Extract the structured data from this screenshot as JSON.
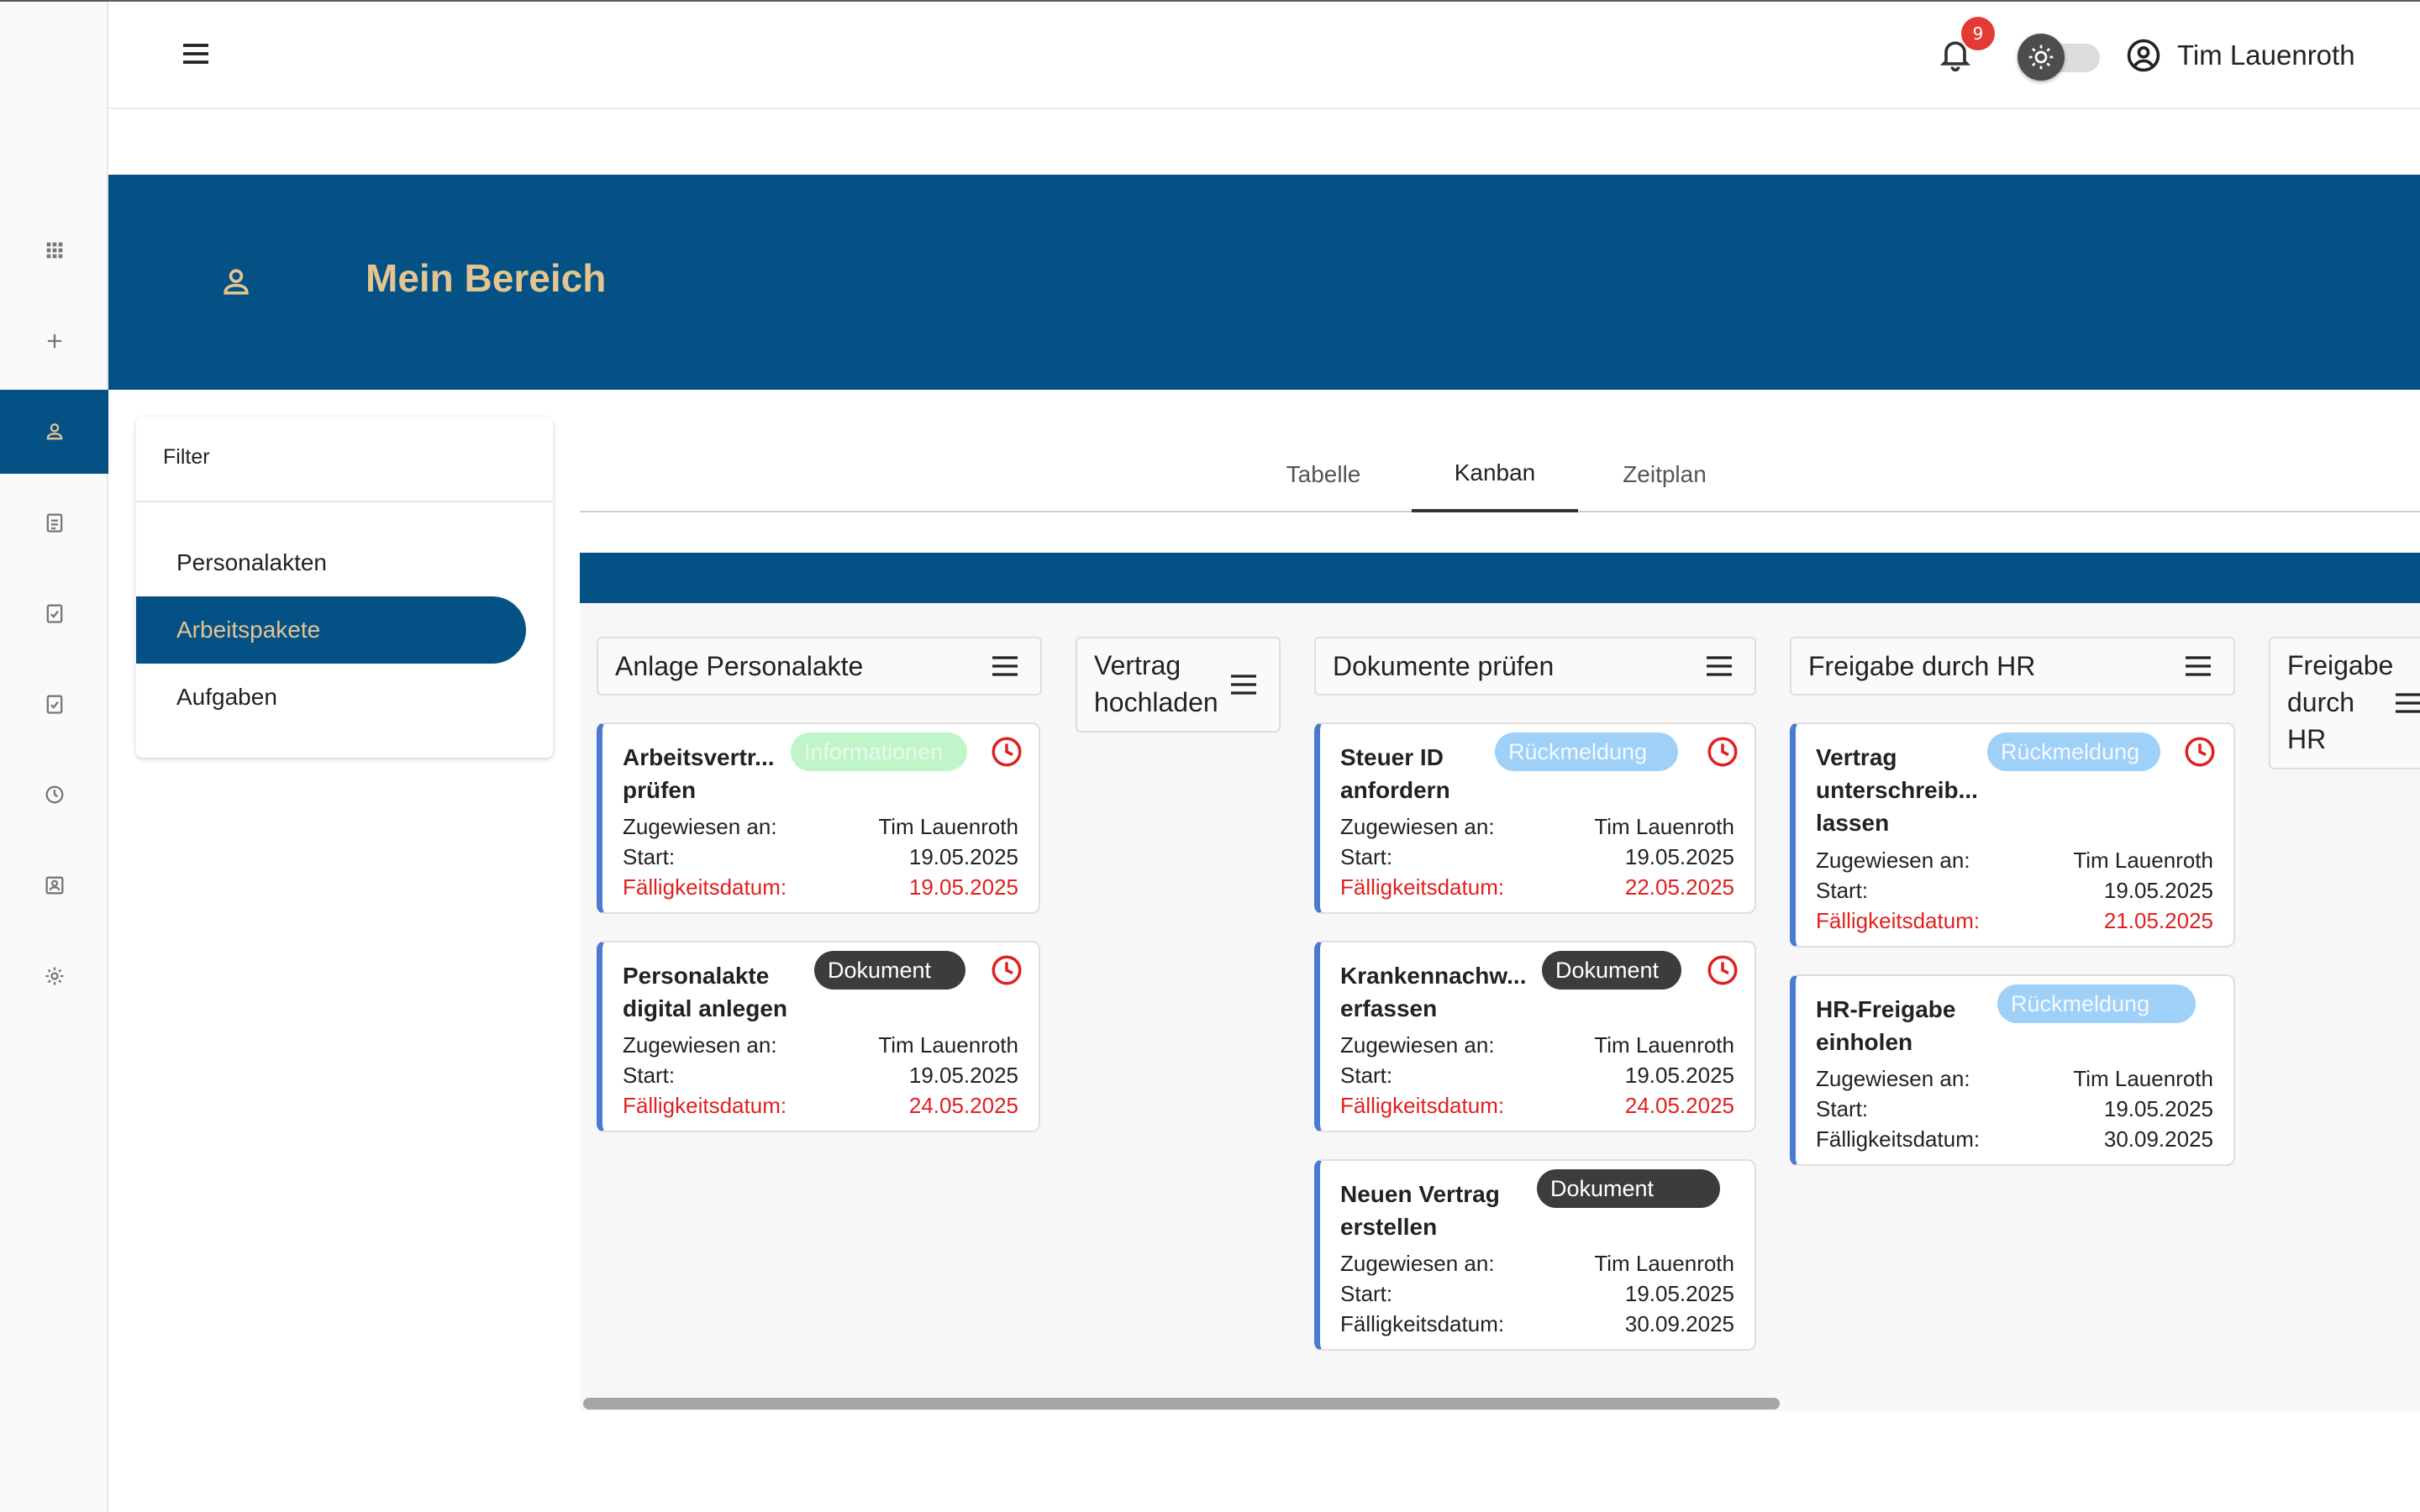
{
  "colors": {
    "primary": "#045186",
    "accent": "#e3c590",
    "due": "#e02020",
    "notification": "#e53935"
  },
  "rail": {
    "items": [
      {
        "icon": "apps-grid-icon"
      },
      {
        "icon": "plus-icon"
      },
      {
        "icon": "person-icon",
        "active": true
      },
      {
        "icon": "clipboard-icon"
      },
      {
        "icon": "clipboard-check-icon"
      },
      {
        "icon": "clipboard-check-icon"
      },
      {
        "icon": "clock-icon"
      },
      {
        "icon": "contact-card-icon"
      },
      {
        "icon": "gear-icon"
      }
    ]
  },
  "topbar": {
    "menu_icon": "hamburger-menu-icon",
    "notification_count": "9",
    "theme_icon": "sun-icon",
    "user_name": "Tim Lauenroth"
  },
  "header": {
    "icon": "person-icon",
    "title": "Mein Bereich"
  },
  "filter": {
    "title": "Filter",
    "items": [
      {
        "label": "Personalakten",
        "active": false
      },
      {
        "label": "Arbeitspakete",
        "active": true
      },
      {
        "label": "Aufgaben",
        "active": false
      }
    ]
  },
  "tabs": [
    {
      "label": "Tabelle",
      "active": false
    },
    {
      "label": "Kanban",
      "active": true
    },
    {
      "label": "Zeitplan",
      "active": false
    }
  ],
  "kanban": {
    "columns": [
      {
        "title": "Anlage Personalakte",
        "cards": [
          {
            "title": "Arbeitsvertr... prüfen",
            "tag": "Informationen",
            "assigned_label": "Zugewiesen an:",
            "assigned": "Tim Lauenroth",
            "start_label": "Start:",
            "start": "19.05.2025",
            "due_label": "Fälligkeitsdatum:",
            "due": "19.05.2025",
            "overdue": true
          },
          {
            "title": "Personalakte digital anlegen",
            "tag": "Dokument",
            "assigned_label": "Zugewiesen an:",
            "assigned": "Tim Lauenroth",
            "start_label": "Start:",
            "start": "19.05.2025",
            "due_label": "Fälligkeitsdatum:",
            "due": "24.05.2025",
            "overdue": true
          }
        ]
      },
      {
        "title": "Vertrag hochladen",
        "cards": []
      },
      {
        "title": "Dokumente prüfen",
        "cards": [
          {
            "title": "Steuer ID anfordern",
            "tag": "Rückmeldung",
            "assigned_label": "Zugewiesen an:",
            "assigned": "Tim Lauenroth",
            "start_label": "Start:",
            "start": "19.05.2025",
            "due_label": "Fälligkeitsdatum:",
            "due": "22.05.2025",
            "overdue": true
          },
          {
            "title": "Krankennachw... erfassen",
            "tag": "Dokument",
            "assigned_label": "Zugewiesen an:",
            "assigned": "Tim Lauenroth",
            "start_label": "Start:",
            "start": "19.05.2025",
            "due_label": "Fälligkeitsdatum:",
            "due": "24.05.2025",
            "overdue": true
          },
          {
            "title": "Neuen Vertrag erstellen",
            "tag": "Dokument",
            "assigned_label": "Zugewiesen an:",
            "assigned": "Tim Lauenroth",
            "start_label": "Start:",
            "start": "19.05.2025",
            "due_label": "Fälligkeitsdatum:",
            "due": "30.09.2025",
            "overdue": false
          }
        ]
      },
      {
        "title": "Freigabe durch HR",
        "cards": [
          {
            "title": "Vertrag unterschreib... lassen",
            "tag": "Rückmeldung",
            "assigned_label": "Zugewiesen an:",
            "assigned": "Tim Lauenroth",
            "start_label": "Start:",
            "start": "19.05.2025",
            "due_label": "Fälligkeitsdatum:",
            "due": "21.05.2025",
            "overdue": true
          },
          {
            "title": "HR-Freigabe einholen",
            "tag": "Rückmeldung",
            "assigned_label": "Zugewiesen an:",
            "assigned": "Tim Lauenroth",
            "start_label": "Start:",
            "start": "19.05.2025",
            "due_label": "Fälligkeitsdatum:",
            "due": "30.09.2025",
            "overdue": false
          }
        ]
      },
      {
        "title": "Freigabe durch HR",
        "cards": []
      }
    ]
  }
}
